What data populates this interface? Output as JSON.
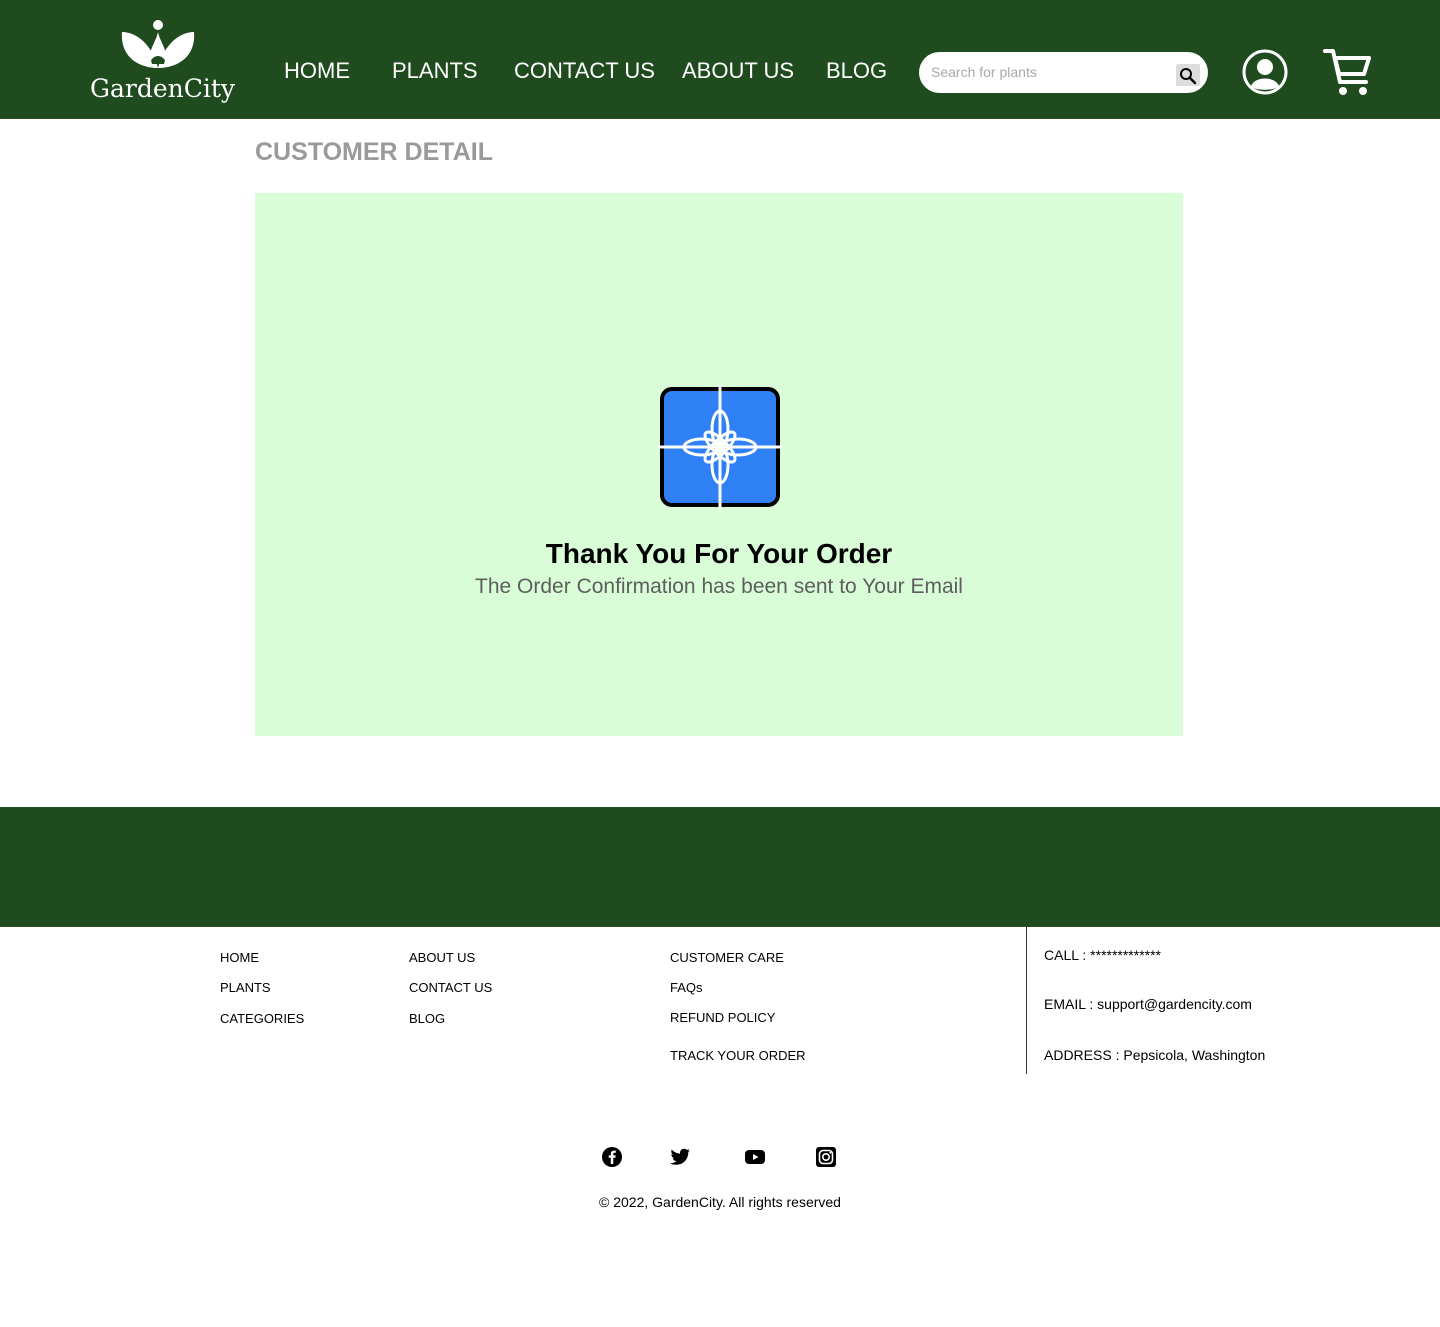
{
  "header": {
    "brand": "GardenCity",
    "nav": [
      {
        "label": "HOME"
      },
      {
        "label": "PLANTS"
      },
      {
        "label": "CONTACT US"
      },
      {
        "label": "ABOUT US"
      },
      {
        "label": "BLOG"
      }
    ],
    "search": {
      "placeholder": "Search for plants",
      "value": ""
    },
    "icons": [
      "search-icon",
      "account-icon",
      "cart-icon"
    ]
  },
  "main": {
    "title": "CUSTOMER DETAIL",
    "thanks": "Thank You For Your Order",
    "confirmation": "The Order Confirmation has been sent to Your Email",
    "icon": "gift-box-icon"
  },
  "footer": {
    "col1": [
      "HOME",
      "PLANTS",
      "CATEGORIES"
    ],
    "col2": [
      "ABOUT US",
      "CONTACT US",
      "BLOG"
    ],
    "col3": [
      "CUSTOMER CARE",
      "FAQs",
      "REFUND POLICY",
      "TRACK YOUR ORDER"
    ],
    "contact": {
      "call": "CALL : *************",
      "email": "EMAIL : support@gardencity.com",
      "address": "ADDRESS : Pepsicola, Washington"
    },
    "social": [
      "facebook-icon",
      "twitter-icon",
      "youtube-icon",
      "instagram-icon"
    ],
    "copyright": "© 2022, GardenCity. All rights reserved"
  },
  "colors": {
    "brand_green": "#1f4b1e",
    "panel_bg": "#d9fdd6",
    "gift_blue": "#2f80f5"
  }
}
